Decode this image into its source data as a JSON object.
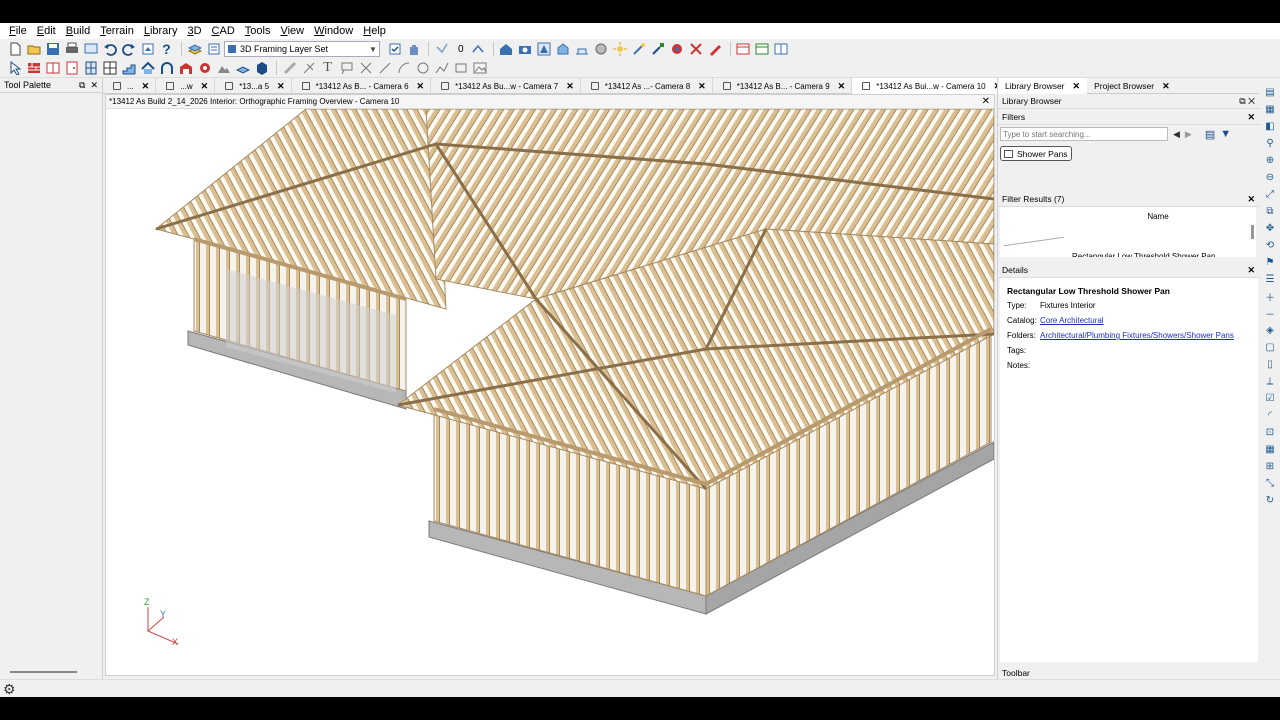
{
  "menu": [
    "File",
    "Edit",
    "Build",
    "Terrain",
    "Library",
    "3D",
    "CAD",
    "Tools",
    "View",
    "Window",
    "Help"
  ],
  "toolbar": {
    "layer_set": "3D Framing Layer Set",
    "layer_count": "0",
    "icons_row1": [
      "new-file-icon",
      "open-folder-icon",
      "save-icon",
      "print-icon",
      "plan-view-icon",
      "undo-icon",
      "redo-icon",
      "view-icon",
      "help-icon",
      "layer-icon",
      "layer-props-icon"
    ],
    "icons_row2": [
      "select-icon",
      "wall-icon",
      "cabinet-icon",
      "door-icon",
      "window-icon",
      "stairs-icon",
      "roof-icon",
      "dimension-icon",
      "text-icon",
      "line-icon",
      "arc-icon",
      "circle-icon"
    ]
  },
  "tool_palette": {
    "title": "Tool Palette"
  },
  "tabs": [
    {
      "label": "...",
      "active": false
    },
    {
      "label": "...w",
      "active": false
    },
    {
      "label": "*13...a 5",
      "active": false
    },
    {
      "label": "*13412 As B... - Camera 6",
      "active": false
    },
    {
      "label": "*13412 As Bu...w - Camera 7",
      "active": false
    },
    {
      "label": "*13412 As ...- Camera 8",
      "active": false
    },
    {
      "label": "*13412 As B... - Camera 9",
      "active": false
    },
    {
      "label": "*13412 As Bui...w - Camera 10",
      "active": true
    }
  ],
  "viewport": {
    "title": "*13412 As Build 2_14_2026 Interior: Orthographic Framing Overview - Camera 10",
    "axis": {
      "z": "Z",
      "y": "Y",
      "x": "X"
    }
  },
  "right_tabs": [
    {
      "label": "Library Browser",
      "active": true
    },
    {
      "label": "Project Browser",
      "active": false
    }
  ],
  "library": {
    "title": "Library Browser",
    "filters_title": "Filters",
    "search_placeholder": "Type to start searching...",
    "filter_chip": "Shower Pans",
    "results_title": "Filter Results (7)",
    "results_column": "Name",
    "result_item": "Rectangular Low Threshold Shower Pan"
  },
  "details": {
    "title": "Details",
    "item_name": "Rectangular Low Threshold Shower Pan",
    "rows": [
      {
        "key": "Type:",
        "value": "Fixtures Interior",
        "link": false
      },
      {
        "key": "Catalog:",
        "value": "Core Architectural",
        "link": true
      },
      {
        "key": "Folders:",
        "value": "Architectural/Plumbing Fixtures/Showers/Shower Pans",
        "link": true
      },
      {
        "key": "Tags:",
        "value": "",
        "link": false
      },
      {
        "key": "Notes:",
        "value": "",
        "link": false
      }
    ]
  },
  "toolbar_panel": {
    "title": "Toolbar"
  },
  "colors": {
    "wood": "#d9bf92",
    "wood_dark": "#a68a5f",
    "slab": "#b7b7b7",
    "link": "#1a2fc8"
  }
}
